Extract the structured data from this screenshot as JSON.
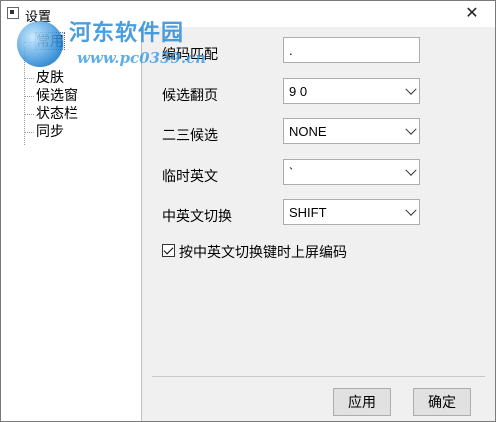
{
  "window": {
    "title": "设置",
    "close_glyph": "✕"
  },
  "watermark": {
    "title": "河东软件园",
    "url": "www.pc0359.cn"
  },
  "sidebar": {
    "items": [
      {
        "label": "常用",
        "selected": true
      },
      {
        "label": "皮肤",
        "selected": false
      },
      {
        "label": "候选窗",
        "selected": false
      },
      {
        "label": "状态栏",
        "selected": false
      },
      {
        "label": "同步",
        "selected": false
      }
    ]
  },
  "settings": {
    "encode_match": {
      "label": "编码匹配",
      "value": "."
    },
    "page_keys": {
      "label": "候选翻页",
      "value": "9 0"
    },
    "second_third": {
      "label": "二三候选",
      "value": "NONE"
    },
    "temp_english": {
      "label": "临时英文",
      "value": "`"
    },
    "toggle_cn_en": {
      "label": "中英文切换",
      "value": "SHIFT"
    },
    "commit_on_toggle": {
      "label": "按中英文切换键时上屏编码",
      "checked": true
    }
  },
  "buttons": {
    "apply": "应用",
    "ok": "确定"
  }
}
